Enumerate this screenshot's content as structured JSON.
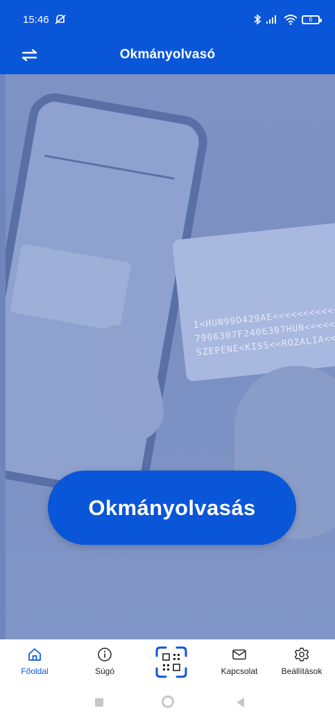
{
  "status_bar": {
    "time": "15:46",
    "mute_icon": "bell-off-icon",
    "battery_level": "6"
  },
  "header": {
    "title": "Okmányolvasó",
    "back_icon": "swap-arrows-icon"
  },
  "main": {
    "cta_label": "Okmányolvasás",
    "background": "phone-and-id-card-photo",
    "mrz_lines": [
      "I<HUN99D429AE<<<<<<<<<<<",
      "7906307F2406307HUN<<<<<<",
      "SZEPENE<KISS<<ROZALIA<<<"
    ]
  },
  "bottom_nav": {
    "items": [
      {
        "label": "Főoldal",
        "icon": "home-icon",
        "active": true
      },
      {
        "label": "Súgó",
        "icon": "info-icon",
        "active": false
      },
      {
        "label": "",
        "icon": "qr-scan-icon",
        "active": false
      },
      {
        "label": "Kapcsolat",
        "icon": "envelope-icon",
        "active": false
      },
      {
        "label": "Beállítások",
        "icon": "gear-icon",
        "active": false
      }
    ]
  },
  "colors": {
    "primary": "#0a56d8",
    "hero_overlay": "#7e92c3",
    "nav_inactive": "#222222"
  }
}
